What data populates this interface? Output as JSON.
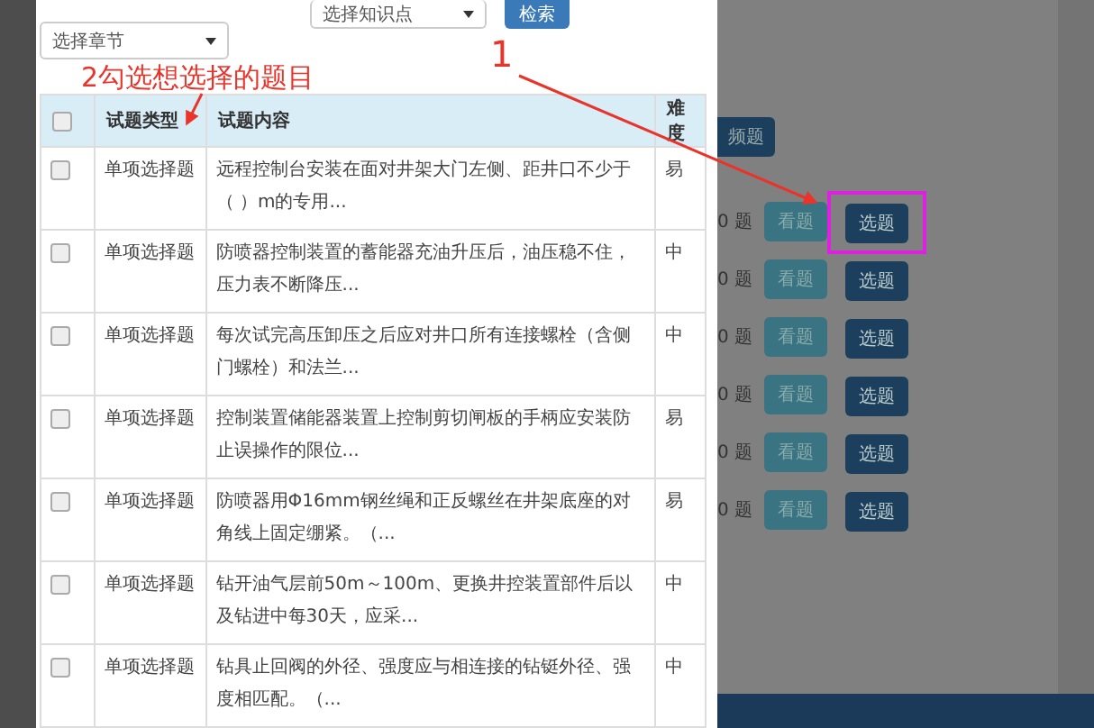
{
  "filters": {
    "chapter_select": "选择章节",
    "knowledge_select": "选择知识点",
    "search_button": "检索"
  },
  "table": {
    "header_checked": false,
    "columns": [
      "试题类型",
      "试题内容",
      "难度"
    ],
    "rows": [
      {
        "checked": false,
        "type": "单项选择题",
        "content": "远程控制台安装在面对井架大门左侧、距井口不少于（ ）m的专用...",
        "difficulty": "易"
      },
      {
        "checked": false,
        "type": "单项选择题",
        "content": "防喷器控制装置的蓄能器充油升压后，油压稳不住，压力表不断降压...",
        "difficulty": "中"
      },
      {
        "checked": false,
        "type": "单项选择题",
        "content": "每次试完高压卸压之后应对井口所有连接螺栓（含侧门螺栓）和法兰...",
        "difficulty": "中"
      },
      {
        "checked": false,
        "type": "单项选择题",
        "content": "控制装置储能器装置上控制剪切闸板的手柄应安装防止误操作的限位...",
        "difficulty": "易"
      },
      {
        "checked": false,
        "type": "单项选择题",
        "content": "防喷器用Φ16mm钢丝绳和正反螺丝在井架底座的对角线上固定绷紧。（...",
        "difficulty": "易"
      },
      {
        "checked": false,
        "type": "单项选择题",
        "content": "钻开油气层前50m～100m、更换井控装置部件后以及钻进中每30天，应采...",
        "difficulty": "中"
      },
      {
        "checked": false,
        "type": "单项选择题",
        "content": "钻具止回阀的外径、强度应与相连接的钻铤外径、强度相匹配。（...",
        "difficulty": "中"
      }
    ]
  },
  "background": {
    "top_button": "频题",
    "rows": [
      {
        "count": "0 题",
        "view": "看题",
        "pick": "选题",
        "highlighted": true
      },
      {
        "count": "0 题",
        "view": "看题",
        "pick": "选题",
        "highlighted": false
      },
      {
        "count": "0 题",
        "view": "看题",
        "pick": "选题",
        "highlighted": false
      },
      {
        "count": "0 题",
        "view": "看题",
        "pick": "选题",
        "highlighted": false
      },
      {
        "count": "0 题",
        "view": "看题",
        "pick": "选题",
        "highlighted": false
      },
      {
        "count": "0 题",
        "view": "看题",
        "pick": "选题",
        "highlighted": false
      }
    ]
  },
  "annotations": [
    {
      "kind": "step-note",
      "label": "2勾选想选择的题目"
    },
    {
      "kind": "step-number",
      "label": "1"
    }
  ]
}
